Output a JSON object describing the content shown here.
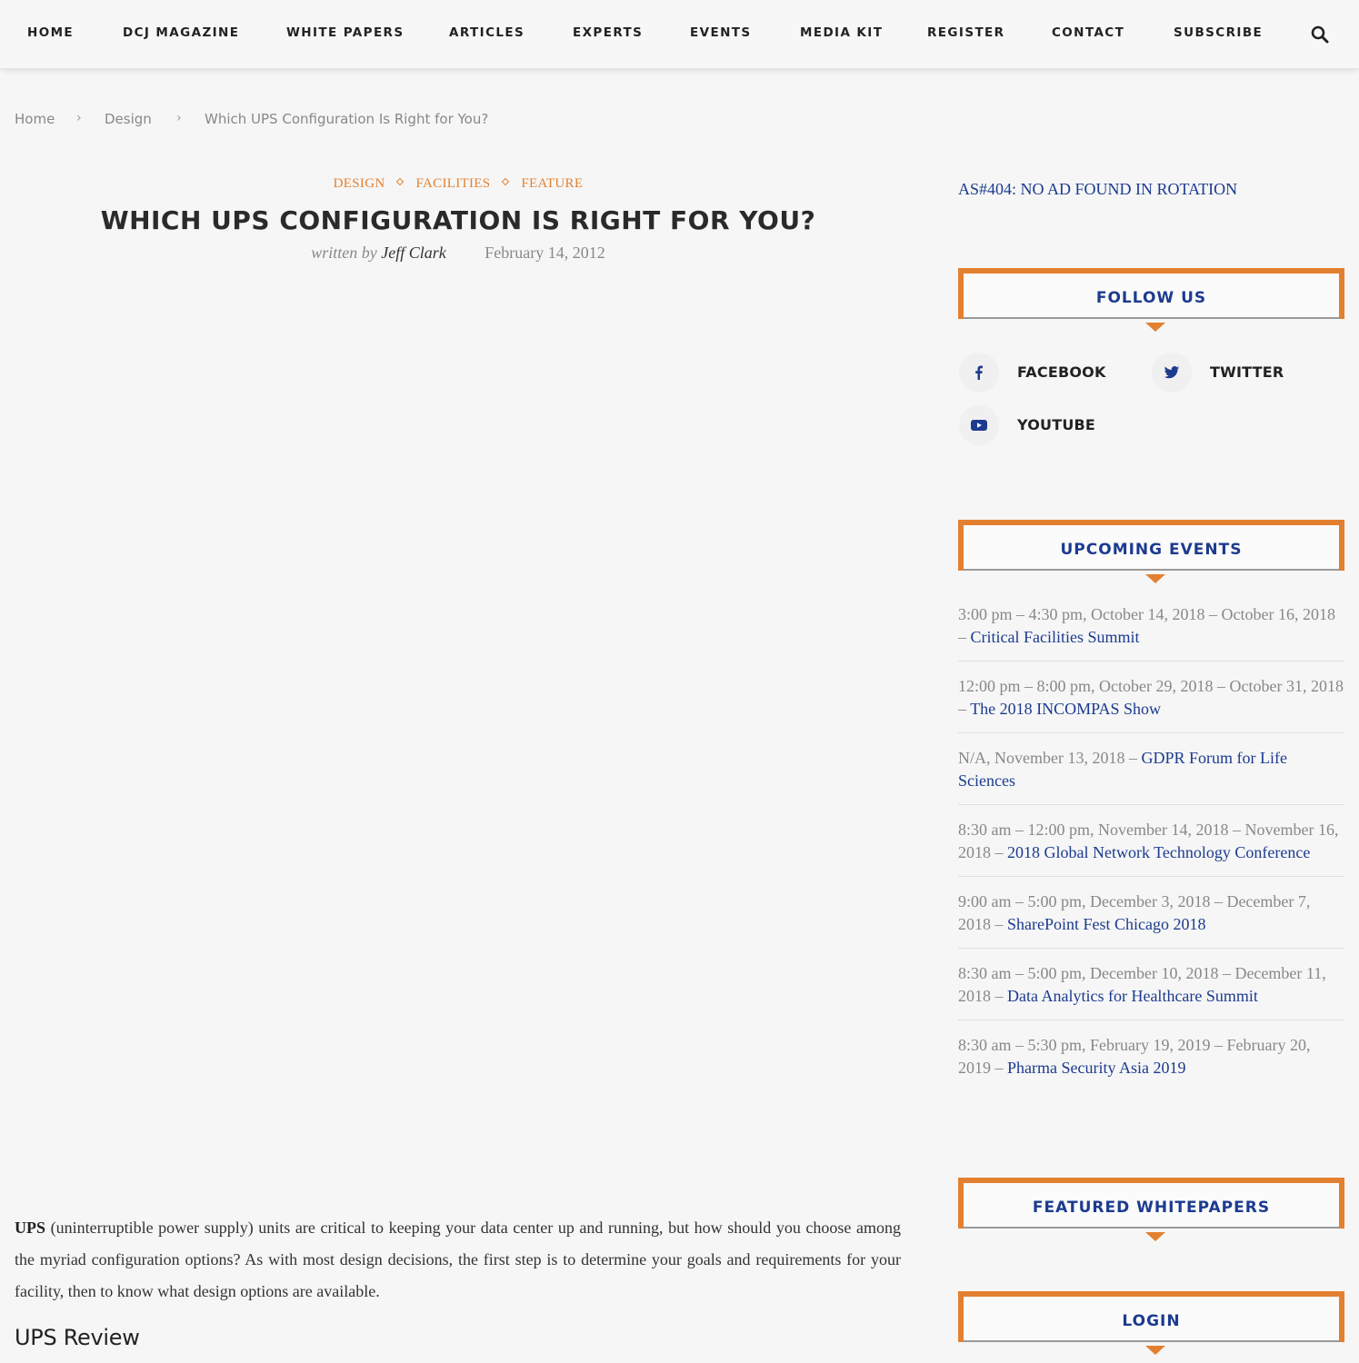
{
  "nav": {
    "items": [
      {
        "label": "HOME"
      },
      {
        "label": "DCJ MAGAZINE"
      },
      {
        "label": "WHITE PAPERS"
      },
      {
        "label": "ARTICLES"
      },
      {
        "label": "EXPERTS"
      },
      {
        "label": "EVENTS"
      },
      {
        "label": "MEDIA KIT"
      },
      {
        "label": "REGISTER"
      },
      {
        "label": "CONTACT"
      },
      {
        "label": "SUBSCRIBE"
      }
    ],
    "search_icon": "search-icon"
  },
  "breadcrumb": {
    "home": "Home",
    "category": "Design",
    "current": "Which UPS Configuration Is Right for You?",
    "separator": "›"
  },
  "article": {
    "categories": [
      "DESIGN",
      "FACILITIES",
      "FEATURE"
    ],
    "title": "WHICH UPS CONFIGURATION IS RIGHT FOR YOU?",
    "written_by": "written by",
    "author": "Jeff Clark",
    "date": "February 14, 2012",
    "intro_bold": "UPS",
    "intro_rest": " (uninterruptible power supply) units are critical to keeping your data center up and running, but how should you choose among the myriad configuration options? As with most design decisions, the first step is to determine your goals and requirements for your facility, then to know what design options are available.",
    "subheading": "UPS Review"
  },
  "sidebar": {
    "ad_text": "AS#404: NO AD FOUND IN ROTATION",
    "follow_us": {
      "title": "FOLLOW US",
      "links": [
        {
          "label": "FACEBOOK",
          "icon": "facebook-icon"
        },
        {
          "label": "TWITTER",
          "icon": "twitter-icon"
        },
        {
          "label": "YOUTUBE",
          "icon": "youtube-icon"
        }
      ]
    },
    "upcoming_events": {
      "title": "UPCOMING EVENTS",
      "items": [
        {
          "when": "3:00 pm – 4:30 pm, October 14, 2018 – October 16, 2018 – ",
          "name": "Critical Facilities Summit"
        },
        {
          "when": "12:00 pm – 8:00 pm, October 29, 2018 – October 31, 2018 – ",
          "name": "The 2018 INCOMPAS Show"
        },
        {
          "when": "N/A, November 13, 2018 – ",
          "name": "GDPR Forum for Life Sciences"
        },
        {
          "when": "8:30 am – 12:00 pm, November 14, 2018 – November 16, 2018 – ",
          "name": "2018 Global Network Technology Conference"
        },
        {
          "when": "9:00 am – 5:00 pm, December 3, 2018 – December 7, 2018 – ",
          "name": "SharePoint Fest Chicago 2018"
        },
        {
          "when": "8:30 am – 5:00 pm, December 10, 2018 – December 11, 2018 – ",
          "name": "Data Analytics for Healthcare Summit"
        },
        {
          "when": "8:30 am – 5:30 pm, February 19, 2019 – February 20, 2019 – ",
          "name": "Pharma Security Asia 2019"
        }
      ]
    },
    "featured_whitepapers": {
      "title": "FEATURED WHITEPAPERS"
    },
    "login": {
      "title": "LOGIN"
    }
  },
  "colors": {
    "accent_orange": "#e3802f",
    "link_blue": "#1c3b8f",
    "text_gray": "#888888"
  }
}
